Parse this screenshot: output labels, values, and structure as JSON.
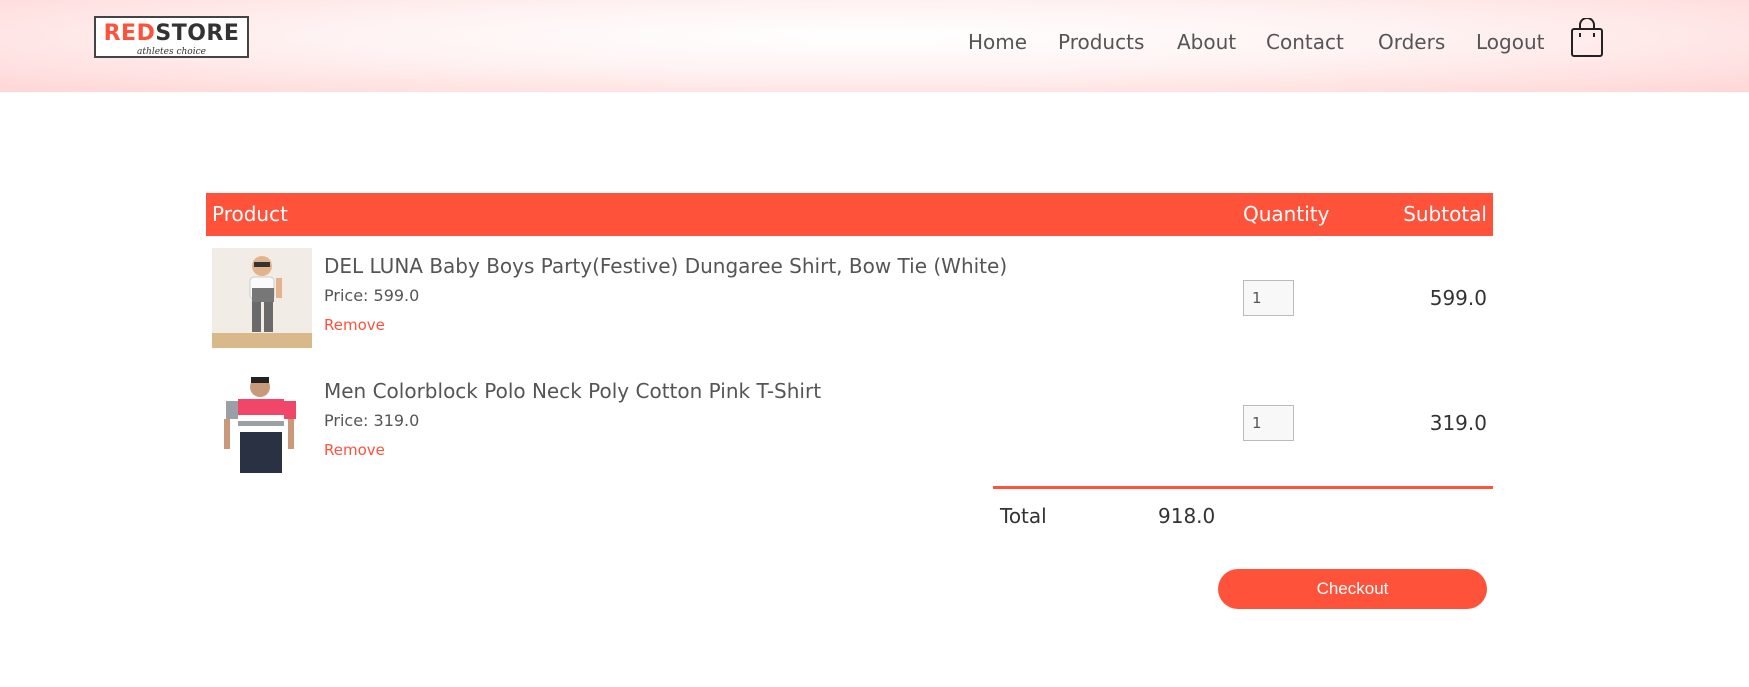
{
  "brand": {
    "logo_red": "RED",
    "logo_dark": "STORE",
    "tagline": "athletes choice",
    "accent_color": "#ff523b"
  },
  "nav": {
    "items": [
      {
        "label": "Home"
      },
      {
        "label": "Products"
      },
      {
        "label": "About"
      },
      {
        "label": "Contact"
      },
      {
        "label": "Orders"
      },
      {
        "label": "Logout"
      }
    ],
    "cart_icon": "shopping-bag-icon"
  },
  "cart": {
    "headers": {
      "product": "Product",
      "quantity": "Quantity",
      "subtotal": "Subtotal"
    },
    "items": [
      {
        "name": "DEL LUNA Baby Boys Party(Festive) Dungaree Shirt, Bow Tie (White)",
        "price": "Price: 599.0",
        "remove": "Remove",
        "quantity": "1",
        "subtotal": "599.0"
      },
      {
        "name": "Men Colorblock Polo Neck Poly Cotton Pink T-Shirt",
        "price": "Price: 319.0",
        "remove": "Remove",
        "quantity": "1",
        "subtotal": "319.0"
      }
    ],
    "total_label": "Total",
    "total_value": "918.0",
    "checkout_label": "Checkout"
  }
}
